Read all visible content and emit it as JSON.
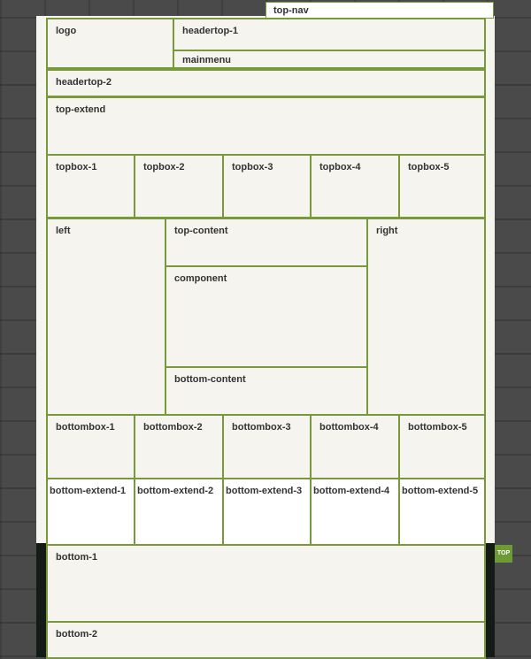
{
  "top_nav": {
    "label": "top-nav"
  },
  "header": {
    "logo": "logo",
    "headertop_1": "headertop-1",
    "mainmenu": "mainmenu",
    "headertop_2": "headertop-2",
    "top_extend": "top-extend"
  },
  "topboxes": [
    "topbox-1",
    "topbox-2",
    "topbox-3",
    "topbox-4",
    "topbox-5"
  ],
  "main": {
    "left": "left",
    "top_content": "top-content",
    "component": "component",
    "bottom_content": "bottom-content",
    "right": "right"
  },
  "bottomboxes": [
    "bottombox-1",
    "bottombox-2",
    "bottombox-3",
    "bottombox-4",
    "bottombox-5"
  ],
  "bottom_extends": [
    "bottom-extend-1",
    "bottom-extend-2",
    "bottom-extend-3",
    "bottom-extend-4",
    "bottom-extend-5"
  ],
  "footer": {
    "bottom_1": "bottom-1",
    "bottom_2": "bottom-2"
  },
  "top_button": "TOP",
  "colors": {
    "accent": "#77993b",
    "panel": "#f6f4ee",
    "dark_band": "#141a16"
  }
}
